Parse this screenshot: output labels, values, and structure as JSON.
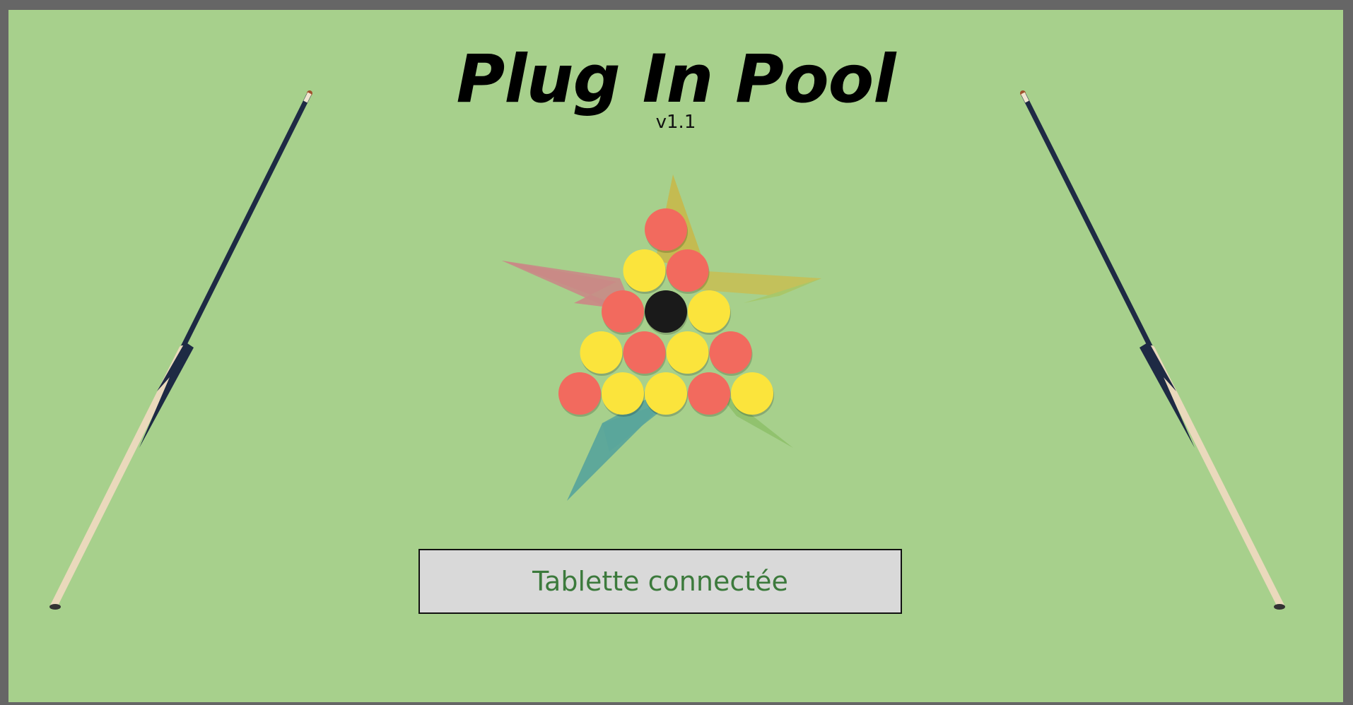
{
  "app": {
    "title": "Plug In Pool",
    "version": "v1.1",
    "background_color": "#a7d08c",
    "frame_color": "#666666"
  },
  "status": {
    "label": "Tablette connectée",
    "text_color": "#3c7a3c",
    "box_color": "#d9d9d9"
  },
  "balls": {
    "rows": [
      [
        "red"
      ],
      [
        "yellow",
        "red"
      ],
      [
        "red",
        "black",
        "yellow"
      ],
      [
        "yellow",
        "red",
        "yellow",
        "red"
      ],
      [
        "red",
        "yellow",
        "yellow",
        "red",
        "yellow"
      ]
    ],
    "colors": {
      "red": "#f26a5e",
      "yellow": "#fbe43c",
      "black": "#1a1a1a"
    }
  },
  "decorations": {
    "left_cue": "pool-cue-icon",
    "right_cue": "pool-cue-icon",
    "star_logo": "star-logo-icon"
  }
}
